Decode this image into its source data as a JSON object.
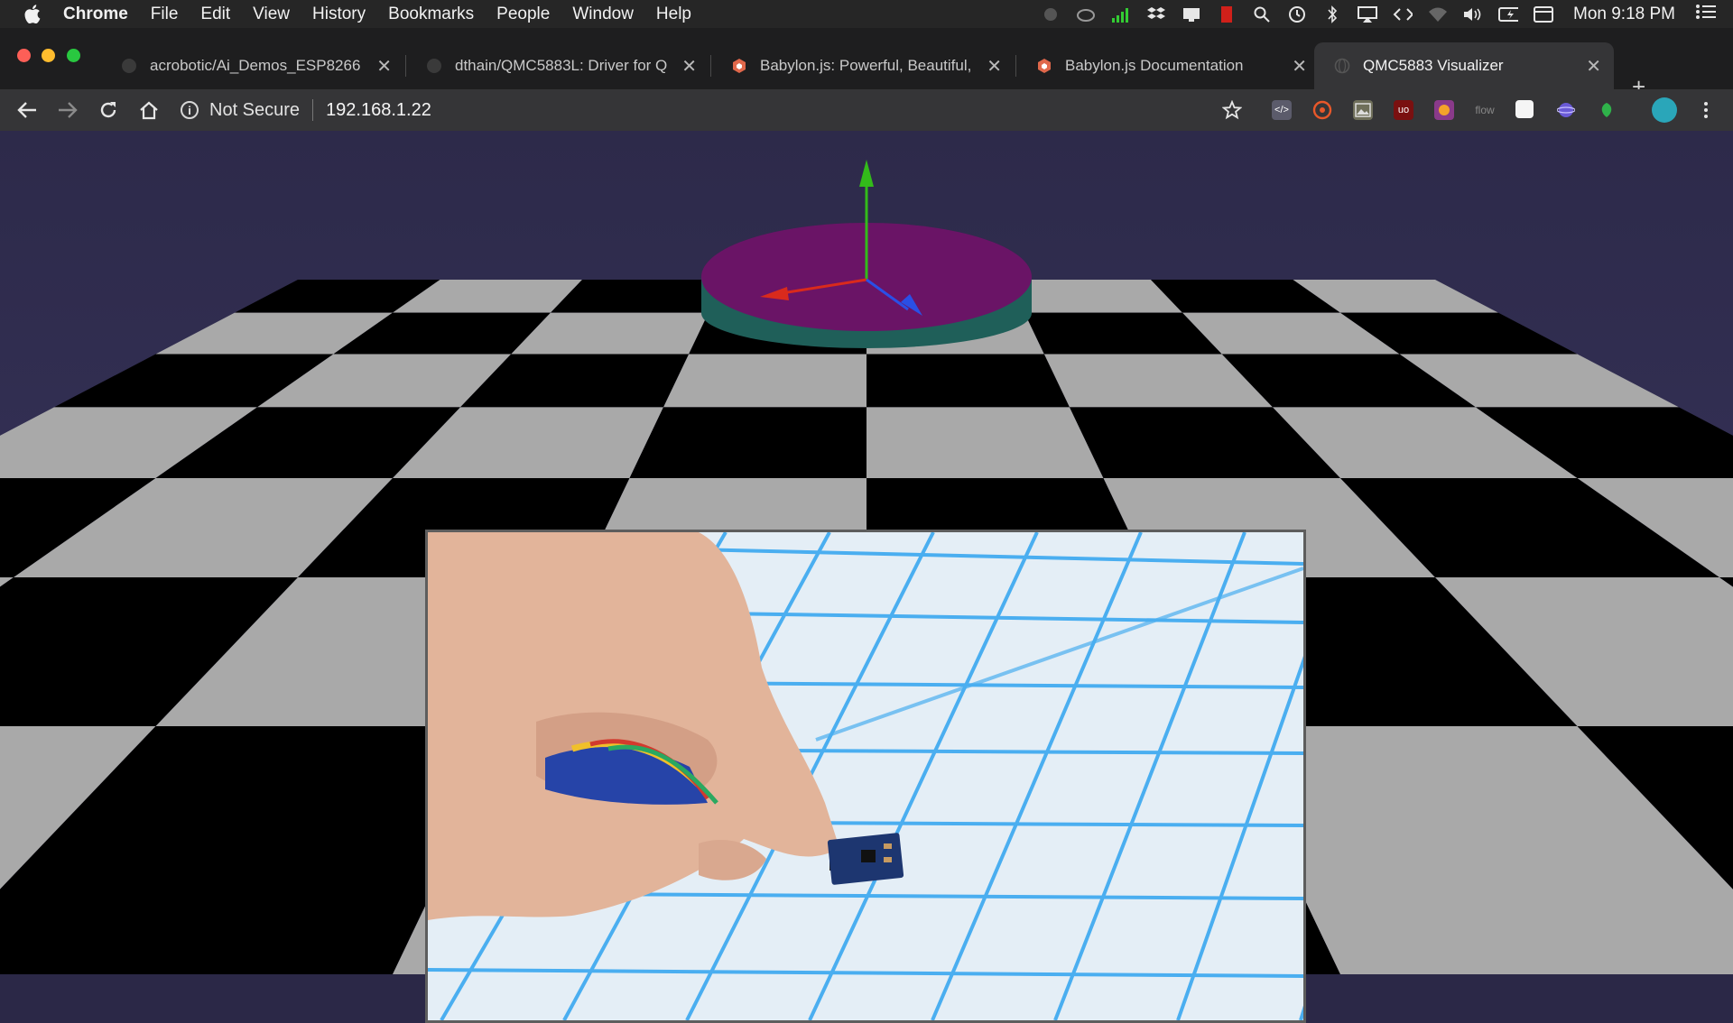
{
  "menubar": {
    "app": "Chrome",
    "items": [
      "File",
      "Edit",
      "View",
      "History",
      "Bookmarks",
      "People",
      "Window",
      "Help"
    ],
    "clock": "Mon 9:18 PM",
    "tray_icons": [
      "record-dot-icon",
      "creative-cloud-icon",
      "signal-bars-icon",
      "dropbox-icon",
      "notification-icon",
      "battery-app-icon",
      "search-icon",
      "time-machine-icon",
      "bluetooth-icon",
      "airplay-icon",
      "code-brackets-icon",
      "wifi-icon",
      "volume-icon",
      "battery-icon",
      "display-icon"
    ]
  },
  "tabs": [
    {
      "title": "acrobotic/Ai_Demos_ESP8266",
      "favicon": "github-icon",
      "active": false
    },
    {
      "title": "dthain/QMC5883L: Driver for Q",
      "favicon": "github-icon",
      "active": false
    },
    {
      "title": "Babylon.js: Powerful, Beautiful,",
      "favicon": "babylon-icon",
      "active": false
    },
    {
      "title": "Babylon.js Documentation",
      "favicon": "babylon-icon",
      "active": false
    },
    {
      "title": "QMC5883 Visualizer",
      "favicon": "globe-icon",
      "active": true
    }
  ],
  "toolbar": {
    "security_label": "Not Secure",
    "url": "192.168.1.22",
    "extensions": [
      "code-extension-icon",
      "hooks-extension-icon",
      "image-extension-icon",
      "ublock-extension-icon",
      "screen-extension-icon",
      "flow-extension-icon",
      "white-square-icon",
      "planet-extension-icon",
      "green-leaf-icon",
      "avatar"
    ],
    "flow_label": "flow",
    "ublock_label": "uo"
  },
  "colors": {
    "background": "#2b2847",
    "checker_light": "#a9a9a9",
    "checker_dark": "#000000",
    "disc_top": "#6a1466",
    "disc_side": "#1f5f59",
    "axis_y": "#33bb1a",
    "axis_x": "#d92a1c",
    "axis_z": "#2a4fe6",
    "grid_line": "#4aaef0"
  }
}
